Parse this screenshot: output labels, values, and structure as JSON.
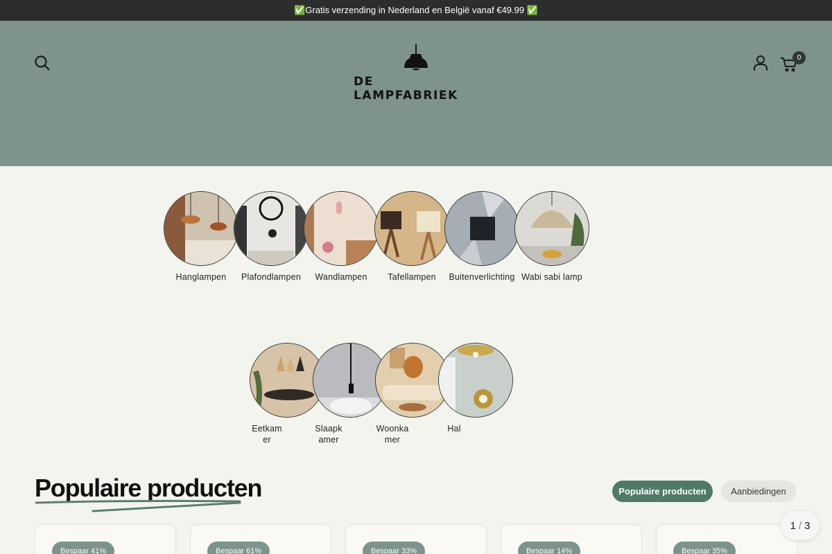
{
  "announcement": "✅Gratis verzending in Nederland en België vanaf €49.99 ✅",
  "header": {
    "logo_text": "DE LAMPFABRIEK",
    "cart_count": "0"
  },
  "categories_row1": [
    {
      "label": "Hanglampen"
    },
    {
      "label": "Plafondlampen"
    },
    {
      "label": "Wandlampen"
    },
    {
      "label": "Tafellampen"
    },
    {
      "label": "Buitenverlichting"
    },
    {
      "label": "Wabi sabi lamp"
    }
  ],
  "categories_row2": [
    {
      "label": "Eetkamer"
    },
    {
      "label": "Slaapkamer"
    },
    {
      "label": "Woonkamer"
    },
    {
      "label": "Hal"
    }
  ],
  "products_section": {
    "title": "Populaire producten",
    "tabs": [
      "Populaire producten",
      "Aanbiedingen"
    ],
    "pager_current": "1",
    "pager_sep": "/",
    "pager_total": "3",
    "cards": [
      {
        "badge": "Bespaar 41%"
      },
      {
        "badge": "Bespaar 61%"
      },
      {
        "badge": "Bespaar 33%"
      },
      {
        "badge": "Bespaar 14%"
      },
      {
        "badge": "Bespaar 35%"
      }
    ]
  },
  "colors": {
    "header_bg": "#7d938b",
    "accent": "#4f7b66",
    "page_bg": "#f4f4ee",
    "announce_bg": "#2b2d2f"
  }
}
